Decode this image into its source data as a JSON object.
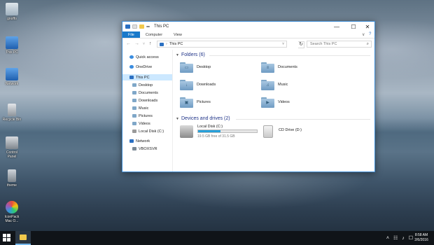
{
  "desktop": {
    "icons": [
      {
        "label": "gnoffo",
        "icon": "user-folder-icon",
        "color": "#c9d3dc"
      },
      {
        "label": "This PC",
        "icon": "computer-icon",
        "color": "#3a7fd0"
      },
      {
        "label": "Network",
        "icon": "network-icon",
        "color": "#3a7fd0"
      },
      {
        "label": "Recycle Bin",
        "icon": "recycle-bin-icon",
        "color": "#c8ccd0"
      },
      {
        "label": "Control Panel",
        "icon": "control-panel-icon",
        "color": "#b0b6bc"
      },
      {
        "label": "theme",
        "icon": "theme-icon",
        "color": "#a8b0b8"
      },
      {
        "label": "IconPack Mac O...",
        "icon": "iconpack-icon",
        "color": "#e8a23a"
      }
    ]
  },
  "window": {
    "title": "This PC",
    "controls": {
      "minimize": "—",
      "maximize": "☐",
      "close": "✕"
    },
    "ribbon": {
      "tabs": [
        "File",
        "Computer",
        "View"
      ],
      "collapse": "∨",
      "help": "?"
    },
    "nav": {
      "back": "←",
      "forward": "→",
      "recent": "˅",
      "up": "↑"
    },
    "address": {
      "separator": "›",
      "path": "This PC",
      "dropdown": "˅",
      "refresh": "↻"
    },
    "search": {
      "placeholder": "Search This PC",
      "icon": "⌕"
    },
    "sidebar": {
      "items": [
        {
          "label": "Quick access",
          "icon": "star-icon",
          "color": "#3b8de0"
        },
        {
          "label": "OneDrive",
          "icon": "cloud-icon",
          "color": "#3b8de0"
        },
        {
          "label": "This PC",
          "icon": "computer-icon",
          "color": "#2b70c2",
          "selected": true
        },
        {
          "label": "Desktop",
          "icon": "desktop-folder-icon",
          "color": "#7fa7c8"
        },
        {
          "label": "Documents",
          "icon": "documents-folder-icon",
          "color": "#7fa7c8"
        },
        {
          "label": "Downloads",
          "icon": "downloads-folder-icon",
          "color": "#7fa7c8"
        },
        {
          "label": "Music",
          "icon": "music-folder-icon",
          "color": "#7fa7c8"
        },
        {
          "label": "Pictures",
          "icon": "pictures-folder-icon",
          "color": "#7fa7c8"
        },
        {
          "label": "Videos",
          "icon": "videos-folder-icon",
          "color": "#7fa7c8"
        },
        {
          "label": "Local Disk (C:)",
          "icon": "local-disk-icon",
          "color": "#9a9a9a"
        },
        {
          "label": "Network",
          "icon": "network-icon",
          "color": "#2b70c2"
        },
        {
          "label": "VBOXSVR",
          "icon": "network-share-icon",
          "color": "#7a8894"
        }
      ]
    },
    "folders": {
      "header": "Folders (6)",
      "items": [
        {
          "label": "Desktop",
          "emblem": "▭"
        },
        {
          "label": "Documents",
          "emblem": "≡"
        },
        {
          "label": "Downloads",
          "emblem": "↓"
        },
        {
          "label": "Music",
          "emblem": "♫"
        },
        {
          "label": "Pictures",
          "emblem": "▣"
        },
        {
          "label": "Videos",
          "emblem": "▶"
        }
      ]
    },
    "drives": {
      "header": "Devices and drives (2)",
      "items": [
        {
          "label": "Local Disk (C:)",
          "free_text": "19.5 GB free of 31.5 GB",
          "used_fraction": 0.38,
          "icon": "hard-drive-icon"
        },
        {
          "label": "CD Drive (D:)",
          "icon": "cd-drive-icon"
        }
      ]
    }
  },
  "taskbar": {
    "tray": {
      "chevron": "˄",
      "network": "☷",
      "volume": "♪",
      "notify": "☐"
    },
    "time": "8:58 AM",
    "date": "2/6/2016"
  },
  "colors": {
    "accent": "#1979ca",
    "selection": "#cce8ff",
    "header_text": "#1e3287",
    "drive_bar": "#26a0da"
  }
}
